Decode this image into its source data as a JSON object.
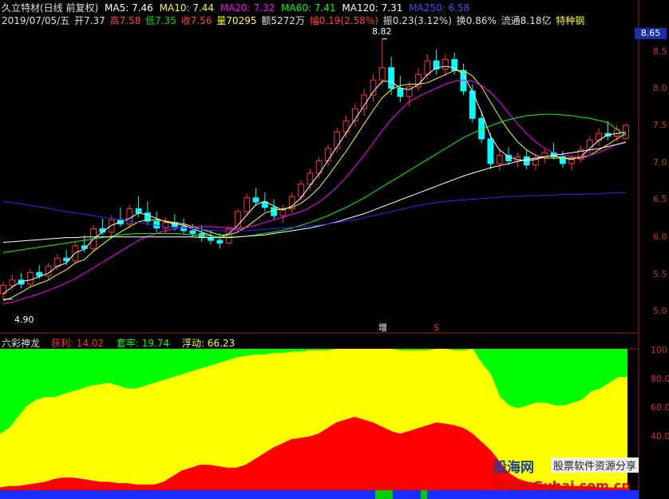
{
  "header": {
    "stock_name": "久立特材(日线 前复权)",
    "ma5": "MA5: 7.46",
    "ma10": "MA10: 7.44",
    "ma20": "MA20: 7.32",
    "ma60": "MA60: 7.41",
    "ma120": "MA120: 7.31",
    "ma250": "MA250: 6.58",
    "date": "2019/07/05/五",
    "open": "开7.37",
    "high": "高7.58",
    "low": "低7.35",
    "close": "收7.56",
    "volume": "量70295",
    "amount": "额5272万",
    "change": "幅0.19(2.58%)",
    "amplitude": "振0.23(3.12%)",
    "turnover": "换0.86%",
    "float_cap": "流通8.18亿",
    "sector": "特种钢"
  },
  "indicator_header": {
    "name": "六彩神龙",
    "profit": "获利: 14.02",
    "trapped": "套牢: 19.74",
    "floating": "浮动: 66.23"
  },
  "price_badge": "8.65",
  "annotations": {
    "high_label": "8.82",
    "low_label": "4.90",
    "marker_zeng": "增",
    "marker_s": "S"
  },
  "watermark": {
    "logo": "股海网",
    "slogan": "股票软件资源分享",
    "url": "www.Guhai.com.cn"
  },
  "colors": {
    "ma5": "#ffffff",
    "ma10": "#ffff00",
    "ma20": "#ff00ff",
    "ma60": "#00ff00",
    "ma120": "#ffffff",
    "ma250": "#1a2fff",
    "up": "#ff3232",
    "down": "#00ffff",
    "profit": "#ff0000",
    "trapped": "#00ff00",
    "floating": "#ffff00"
  },
  "chart_data": [
    {
      "type": "candlestick",
      "title": "久立特材(日线 前复权)",
      "y_ticks": [
        "8.5",
        "8.0",
        "7.5",
        "7.0",
        "6.5",
        "6.0",
        "5.5",
        "5.0"
      ],
      "ylim": [
        4.75,
        8.98
      ],
      "grid": false,
      "candles": [
        [
          5.1,
          5.28,
          5.02,
          5.22
        ],
        [
          5.22,
          5.38,
          5.16,
          5.3
        ],
        [
          5.3,
          5.4,
          5.18,
          5.24
        ],
        [
          5.24,
          5.46,
          5.2,
          5.41
        ],
        [
          5.41,
          5.52,
          5.32,
          5.36
        ],
        [
          5.36,
          5.55,
          5.3,
          5.5
        ],
        [
          5.5,
          5.68,
          5.44,
          5.62
        ],
        [
          5.62,
          5.74,
          5.52,
          5.58
        ],
        [
          5.58,
          5.86,
          5.54,
          5.8
        ],
        [
          5.8,
          5.95,
          5.7,
          5.76
        ],
        [
          5.76,
          6.1,
          5.72,
          6.05
        ],
        [
          6.05,
          6.2,
          5.96,
          6.0
        ],
        [
          6.0,
          6.25,
          5.92,
          6.18
        ],
        [
          6.18,
          6.36,
          6.08,
          6.12
        ],
        [
          6.12,
          6.4,
          6.06,
          6.34
        ],
        [
          6.34,
          6.52,
          6.22,
          6.28
        ],
        [
          6.28,
          6.45,
          6.1,
          6.16
        ],
        [
          6.16,
          6.3,
          6.0,
          6.06
        ],
        [
          6.06,
          6.22,
          5.98,
          6.14
        ],
        [
          6.14,
          6.26,
          6.02,
          6.08
        ],
        [
          6.08,
          6.2,
          5.98,
          6.02
        ],
        [
          6.02,
          6.12,
          5.92,
          5.98
        ],
        [
          5.98,
          6.1,
          5.86,
          5.92
        ],
        [
          5.92,
          6.04,
          5.82,
          5.88
        ],
        [
          5.88,
          5.98,
          5.76,
          5.84
        ],
        [
          5.84,
          6.08,
          5.82,
          6.04
        ],
        [
          6.04,
          6.34,
          6.0,
          6.3
        ],
        [
          6.3,
          6.56,
          6.24,
          6.5
        ],
        [
          6.5,
          6.64,
          6.38,
          6.44
        ],
        [
          6.44,
          6.58,
          6.3,
          6.36
        ],
        [
          6.36,
          6.48,
          6.18,
          6.24
        ],
        [
          6.24,
          6.4,
          6.14,
          6.34
        ],
        [
          6.34,
          6.58,
          6.28,
          6.52
        ],
        [
          6.52,
          6.76,
          6.46,
          6.7
        ],
        [
          6.7,
          6.92,
          6.62,
          6.86
        ],
        [
          6.86,
          7.1,
          6.78,
          7.04
        ],
        [
          7.04,
          7.28,
          6.96,
          7.22
        ],
        [
          7.22,
          7.52,
          7.16,
          7.46
        ],
        [
          7.46,
          7.7,
          7.38,
          7.62
        ],
        [
          7.62,
          7.88,
          7.54,
          7.8
        ],
        [
          7.8,
          8.1,
          7.7,
          8.0
        ],
        [
          8.0,
          8.3,
          7.9,
          8.22
        ],
        [
          8.22,
          8.82,
          8.14,
          8.4
        ],
        [
          8.4,
          8.56,
          8.0,
          8.1
        ],
        [
          8.1,
          8.28,
          7.9,
          7.98
        ],
        [
          7.98,
          8.2,
          7.84,
          8.12
        ],
        [
          8.12,
          8.4,
          8.06,
          8.3
        ],
        [
          8.3,
          8.6,
          8.22,
          8.5
        ],
        [
          8.5,
          8.66,
          8.3,
          8.38
        ],
        [
          8.38,
          8.6,
          8.28,
          8.52
        ],
        [
          8.52,
          8.62,
          8.3,
          8.36
        ],
        [
          8.36,
          8.46,
          8.0,
          8.06
        ],
        [
          8.06,
          8.16,
          7.6,
          7.66
        ],
        [
          7.66,
          7.76,
          7.3,
          7.36
        ],
        [
          7.36,
          7.44,
          6.92,
          7.0
        ],
        [
          7.0,
          7.2,
          6.9,
          7.12
        ],
        [
          7.12,
          7.24,
          6.98,
          7.04
        ],
        [
          7.04,
          7.16,
          6.94,
          7.1
        ],
        [
          7.1,
          7.2,
          6.92,
          6.98
        ],
        [
          6.98,
          7.14,
          6.9,
          7.08
        ],
        [
          7.08,
          7.22,
          7.0,
          7.16
        ],
        [
          7.16,
          7.3,
          7.06,
          7.1
        ],
        [
          7.1,
          7.18,
          6.94,
          7.0
        ],
        [
          7.0,
          7.12,
          6.9,
          7.06
        ],
        [
          7.06,
          7.26,
          7.02,
          7.2
        ],
        [
          7.2,
          7.4,
          7.14,
          7.34
        ],
        [
          7.34,
          7.52,
          7.26,
          7.44
        ],
        [
          7.44,
          7.62,
          7.34,
          7.4
        ],
        [
          7.4,
          7.56,
          7.32,
          7.5
        ],
        [
          7.37,
          7.58,
          7.35,
          7.56
        ]
      ],
      "series": [
        {
          "name": "MA5",
          "values": [
            5.1,
            5.2,
            5.28,
            5.3,
            5.35,
            5.4,
            5.5,
            5.55,
            5.7,
            5.75,
            5.9,
            6.0,
            6.1,
            6.15,
            6.2,
            6.28,
            6.25,
            6.2,
            6.15,
            6.12,
            6.1,
            6.05,
            6.0,
            5.95,
            5.92,
            5.98,
            6.1,
            6.25,
            6.4,
            6.45,
            6.38,
            6.32,
            6.38,
            6.5,
            6.68,
            6.85,
            7.05,
            7.25,
            7.45,
            7.65,
            7.85,
            8.05,
            8.2,
            8.2,
            8.1,
            8.08,
            8.15,
            8.3,
            8.4,
            8.42,
            8.4,
            8.3,
            8.05,
            7.75,
            7.4,
            7.2,
            7.1,
            7.06,
            7.04,
            7.06,
            7.1,
            7.12,
            7.08,
            7.06,
            7.1,
            7.22,
            7.34,
            7.42,
            7.44,
            7.46
          ]
        },
        {
          "name": "MA10",
          "values": [
            5.0,
            5.05,
            5.12,
            5.2,
            5.25,
            5.3,
            5.38,
            5.45,
            5.55,
            5.6,
            5.72,
            5.82,
            5.92,
            6.0,
            6.08,
            6.15,
            6.18,
            6.18,
            6.16,
            6.14,
            6.12,
            6.08,
            6.04,
            6.0,
            5.96,
            5.96,
            6.0,
            6.08,
            6.18,
            6.28,
            6.32,
            6.34,
            6.36,
            6.42,
            6.52,
            6.65,
            6.82,
            7.0,
            7.18,
            7.38,
            7.58,
            7.78,
            7.96,
            8.08,
            8.14,
            8.16,
            8.16,
            8.18,
            8.24,
            8.3,
            8.36,
            8.36,
            8.28,
            8.12,
            7.9,
            7.68,
            7.48,
            7.32,
            7.2,
            7.12,
            7.08,
            7.08,
            7.08,
            7.08,
            7.08,
            7.12,
            7.2,
            7.28,
            7.36,
            7.44
          ]
        },
        {
          "name": "MA20",
          "values": [
            4.95,
            4.98,
            5.02,
            5.06,
            5.1,
            5.15,
            5.2,
            5.26,
            5.32,
            5.4,
            5.48,
            5.56,
            5.64,
            5.72,
            5.8,
            5.88,
            5.94,
            5.98,
            6.02,
            6.05,
            6.07,
            6.08,
            6.08,
            6.08,
            6.07,
            6.06,
            6.06,
            6.07,
            6.1,
            6.14,
            6.18,
            6.22,
            6.26,
            6.3,
            6.36,
            6.44,
            6.54,
            6.66,
            6.8,
            6.96,
            7.12,
            7.3,
            7.48,
            7.64,
            7.78,
            7.9,
            7.98,
            8.04,
            8.1,
            8.16,
            8.2,
            8.22,
            8.2,
            8.14,
            8.04,
            7.9,
            7.74,
            7.58,
            7.44,
            7.32,
            7.22,
            7.16,
            7.12,
            7.1,
            7.1,
            7.12,
            7.16,
            7.22,
            7.28,
            7.32
          ]
        },
        {
          "name": "MA60",
          "values": [
            5.7,
            5.72,
            5.74,
            5.76,
            5.78,
            5.8,
            5.82,
            5.84,
            5.86,
            5.88,
            5.9,
            5.92,
            5.94,
            5.96,
            5.97,
            5.98,
            5.98,
            5.98,
            5.98,
            5.98,
            5.97,
            5.96,
            5.95,
            5.94,
            5.93,
            5.93,
            5.93,
            5.94,
            5.96,
            5.98,
            6.0,
            6.03,
            6.06,
            6.1,
            6.14,
            6.19,
            6.24,
            6.3,
            6.36,
            6.43,
            6.5,
            6.58,
            6.66,
            6.74,
            6.82,
            6.9,
            6.98,
            7.06,
            7.14,
            7.22,
            7.3,
            7.38,
            7.44,
            7.5,
            7.55,
            7.6,
            7.64,
            7.67,
            7.7,
            7.71,
            7.72,
            7.72,
            7.71,
            7.7,
            7.68,
            7.66,
            7.63,
            7.6,
            7.5,
            7.41
          ]
        },
        {
          "name": "MA120",
          "values": [
            5.85,
            5.86,
            5.87,
            5.88,
            5.89,
            5.9,
            5.91,
            5.92,
            5.92,
            5.93,
            5.93,
            5.93,
            5.93,
            5.93,
            5.93,
            5.93,
            5.93,
            5.93,
            5.93,
            5.93,
            5.93,
            5.93,
            5.92,
            5.92,
            5.92,
            5.92,
            5.93,
            5.94,
            5.95,
            5.96,
            5.98,
            6.0,
            6.02,
            6.04,
            6.06,
            6.09,
            6.12,
            6.15,
            6.19,
            6.23,
            6.27,
            6.32,
            6.37,
            6.42,
            6.47,
            6.52,
            6.57,
            6.62,
            6.67,
            6.72,
            6.77,
            6.82,
            6.86,
            6.9,
            6.94,
            6.97,
            7.0,
            7.03,
            7.06,
            7.08,
            7.1,
            7.12,
            7.14,
            7.16,
            7.18,
            7.2,
            7.22,
            7.25,
            7.28,
            7.31
          ]
        },
        {
          "name": "MA250",
          "values": [
            6.45,
            6.43,
            6.41,
            6.39,
            6.37,
            6.35,
            6.32,
            6.3,
            6.28,
            6.26,
            6.24,
            6.22,
            6.2,
            6.18,
            6.16,
            6.14,
            6.12,
            6.1,
            6.08,
            6.07,
            6.06,
            6.05,
            6.04,
            6.03,
            6.02,
            6.02,
            6.02,
            6.02,
            6.03,
            6.04,
            6.05,
            6.06,
            6.07,
            6.08,
            6.09,
            6.1,
            6.12,
            6.14,
            6.16,
            6.18,
            6.21,
            6.24,
            6.27,
            6.3,
            6.33,
            6.36,
            6.39,
            6.41,
            6.43,
            6.45,
            6.46,
            6.47,
            6.48,
            6.49,
            6.5,
            6.51,
            6.52,
            6.52,
            6.53,
            6.53,
            6.54,
            6.54,
            6.55,
            6.55,
            6.55,
            6.56,
            6.56,
            6.57,
            6.57,
            6.58
          ]
        }
      ]
    },
    {
      "type": "area",
      "title": "六彩神龙",
      "y_ticks": [
        "100",
        "80.00",
        "60.00",
        "40.00"
      ],
      "ylim": [
        0,
        100
      ],
      "series": [
        {
          "name": "获利",
          "values": [
            2,
            3,
            3,
            4,
            5,
            6,
            8,
            9,
            9,
            8,
            7,
            6,
            6,
            5,
            5,
            4,
            4,
            4,
            6,
            10,
            14,
            16,
            18,
            18,
            17,
            16,
            16,
            18,
            22,
            26,
            30,
            33,
            36,
            37,
            38,
            40,
            44,
            48,
            50,
            52,
            50,
            48,
            45,
            42,
            40,
            42,
            44,
            46,
            48,
            47,
            46,
            44,
            40,
            34,
            28,
            20,
            12,
            8,
            6,
            5,
            4,
            4,
            3,
            3,
            3,
            3,
            2,
            2,
            2,
            2
          ]
        },
        {
          "name": "套牢",
          "values": [
            40,
            44,
            52,
            60,
            64,
            66,
            66,
            68,
            70,
            72,
            74,
            75,
            76,
            74,
            72,
            72,
            74,
            76,
            78,
            80,
            82,
            84,
            86,
            88,
            90,
            92,
            94,
            95,
            96,
            96,
            97,
            97,
            98,
            98,
            99,
            99,
            99,
            100,
            100,
            100,
            100,
            100,
            100,
            100,
            99,
            99,
            99,
            99,
            100,
            100,
            99,
            99,
            100,
            90,
            82,
            66,
            60,
            58,
            60,
            62,
            62,
            60,
            60,
            62,
            64,
            70,
            72,
            76,
            80,
            80
          ]
        }
      ]
    }
  ]
}
